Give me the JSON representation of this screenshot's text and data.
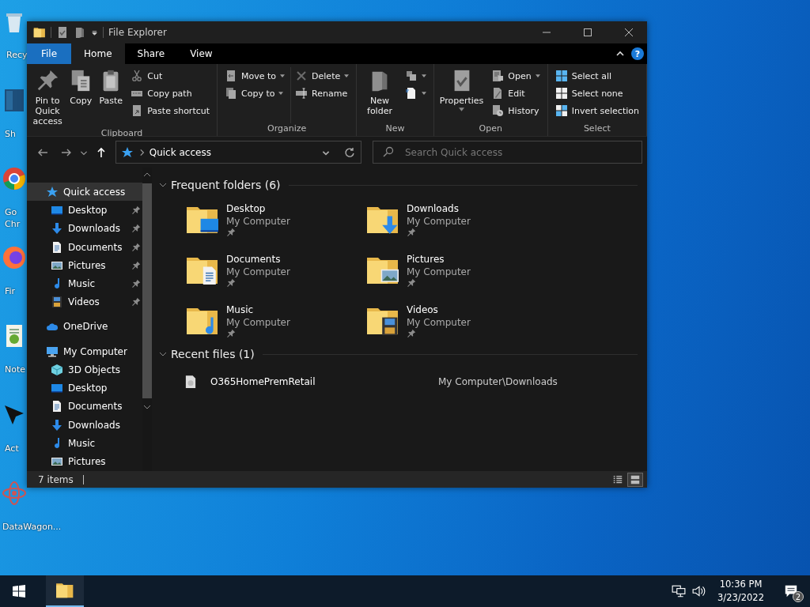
{
  "desktop_icons": [
    {
      "kind": "bin",
      "lines": [
        "Recy"
      ]
    },
    {
      "kind": "tile",
      "lines": [
        "Sh"
      ]
    },
    {
      "kind": "browser",
      "lines": [
        "Go",
        "Chr"
      ]
    },
    {
      "kind": "fox",
      "lines": [
        "Fir"
      ]
    },
    {
      "kind": "notepad",
      "lines": [
        "Note"
      ]
    },
    {
      "kind": "arrow",
      "lines": [
        "Act"
      ]
    },
    {
      "kind": "atom",
      "lines": [
        "DataWagon..."
      ]
    }
  ],
  "window": {
    "title": "File Explorer"
  },
  "ribbon_tabs": [
    {
      "label": "File",
      "kind": "file",
      "selected": false
    },
    {
      "label": "Home",
      "kind": "tab",
      "selected": true
    },
    {
      "label": "Share",
      "kind": "tab",
      "selected": false
    },
    {
      "label": "View",
      "kind": "tab",
      "selected": false
    }
  ],
  "help_label": "?",
  "ribbon_groups": [
    {
      "name": "Clipboard",
      "columns": [
        {
          "kind": "large",
          "items": [
            {
              "kind": "pin",
              "label": "Pin to Quick access",
              "dropdown": false
            }
          ]
        },
        {
          "kind": "large",
          "items": [
            {
              "kind": "copy",
              "label": "Copy",
              "dropdown": false
            }
          ]
        },
        {
          "kind": "large",
          "items": [
            {
              "kind": "paste",
              "label": "Paste",
              "dropdown": false
            }
          ]
        },
        {
          "kind": "stack",
          "items": [
            {
              "kind": "cut",
              "label": "Cut",
              "dropdown": false
            },
            {
              "kind": "copypath",
              "label": "Copy path",
              "dropdown": false
            },
            {
              "kind": "shortcut",
              "label": "Paste shortcut",
              "dropdown": false
            }
          ]
        }
      ]
    },
    {
      "name": "Organize",
      "columns": [
        {
          "kind": "stack",
          "items": [
            {
              "kind": "moveto",
              "label": "Move to",
              "dropdown": true
            },
            {
              "kind": "copyto",
              "label": "Copy to",
              "dropdown": true
            }
          ]
        },
        {
          "kind": "stack",
          "items": [
            {
              "kind": "delete",
              "label": "Delete",
              "dropdown": true
            },
            {
              "kind": "rename",
              "label": "Rename",
              "dropdown": false
            }
          ]
        }
      ]
    },
    {
      "name": "New",
      "columns": [
        {
          "kind": "large",
          "items": [
            {
              "kind": "newfolder",
              "label": "New folder",
              "dropdown": false
            }
          ]
        },
        {
          "kind": "stack",
          "items": [
            {
              "kind": "easyaccess",
              "dropdown": true
            },
            {
              "kind": "newitem",
              "dropdown": true
            }
          ]
        }
      ]
    },
    {
      "name": "Open",
      "columns": [
        {
          "kind": "large",
          "items": [
            {
              "kind": "properties",
              "label": "Properties",
              "dropdown": true
            }
          ]
        },
        {
          "kind": "stack",
          "items": [
            {
              "kind": "open",
              "label": "Open",
              "dropdown": true
            },
            {
              "kind": "edit",
              "label": "Edit",
              "dropdown": false
            },
            {
              "kind": "history",
              "label": "History",
              "dropdown": false
            }
          ]
        }
      ]
    },
    {
      "name": "Select",
      "columns": [
        {
          "kind": "stack",
          "items": [
            {
              "kind": "selectall",
              "label": "Select all",
              "dropdown": false
            },
            {
              "kind": "selectnone",
              "label": "Select none",
              "dropdown": false
            },
            {
              "kind": "invert",
              "label": "Invert selection",
              "dropdown": false
            }
          ]
        }
      ]
    }
  ],
  "address": {
    "path": "Quick access"
  },
  "search": {
    "placeholder": "Search Quick access"
  },
  "tree": [
    {
      "label": "Quick access",
      "kind": "quick",
      "selected": true,
      "children": [
        {
          "label": "Desktop",
          "kind": "desktop",
          "pinned": true,
          "selected": false
        },
        {
          "label": "Downloads",
          "kind": "downloads",
          "pinned": true,
          "selected": false
        },
        {
          "label": "Documents",
          "kind": "documents",
          "pinned": true,
          "selected": false
        },
        {
          "label": "Pictures",
          "kind": "pictures",
          "pinned": true,
          "selected": false
        },
        {
          "label": "Music",
          "kind": "music",
          "pinned": true,
          "selected": false
        },
        {
          "label": "Videos",
          "kind": "videos",
          "pinned": true,
          "selected": false
        }
      ]
    },
    {
      "label": "OneDrive",
      "kind": "onedrive",
      "selected": false
    },
    {
      "label": "My Computer",
      "kind": "computer",
      "selected": false,
      "children": [
        {
          "label": "3D Objects",
          "kind": "objects3d",
          "pinned": false,
          "selected": false
        },
        {
          "label": "Desktop",
          "kind": "desktop",
          "pinned": false,
          "selected": false
        },
        {
          "label": "Documents",
          "kind": "documents",
          "pinned": false,
          "selected": false
        },
        {
          "label": "Downloads",
          "kind": "downloads",
          "pinned": false,
          "selected": false
        },
        {
          "label": "Music",
          "kind": "music",
          "pinned": false,
          "selected": false
        },
        {
          "label": "Pictures",
          "kind": "pictures",
          "pinned": false,
          "selected": false
        }
      ]
    }
  ],
  "sections": [
    {
      "title": "Frequent folders (6)",
      "kind": "tiles",
      "expanded": true,
      "items": [
        {
          "name": "Desktop",
          "location": "My Computer",
          "kind": "desktop",
          "pinned": true
        },
        {
          "name": "Downloads",
          "location": "My Computer",
          "kind": "downloads",
          "pinned": true
        },
        {
          "name": "Documents",
          "location": "My Computer",
          "kind": "documents",
          "pinned": true
        },
        {
          "name": "Pictures",
          "location": "My Computer",
          "kind": "pictures",
          "pinned": true
        },
        {
          "name": "Music",
          "location": "My Computer",
          "kind": "music",
          "pinned": true
        },
        {
          "name": "Videos",
          "location": "My Computer",
          "kind": "videos",
          "pinned": true
        }
      ]
    },
    {
      "title": "Recent files (1)",
      "kind": "list",
      "expanded": true,
      "items": [
        {
          "name": "O365HomePremRetail",
          "location": "My Computer\\Downloads"
        }
      ]
    }
  ],
  "status_bar": {
    "count": "7 items",
    "views": [
      {
        "kind": "details",
        "selected": false
      },
      {
        "kind": "large",
        "selected": true
      }
    ]
  },
  "taskbar": {
    "apps": [
      {
        "kind": "explorer",
        "active": true
      }
    ],
    "time": "10:36 PM",
    "date": "3/23/2022",
    "notification_count": "2"
  }
}
